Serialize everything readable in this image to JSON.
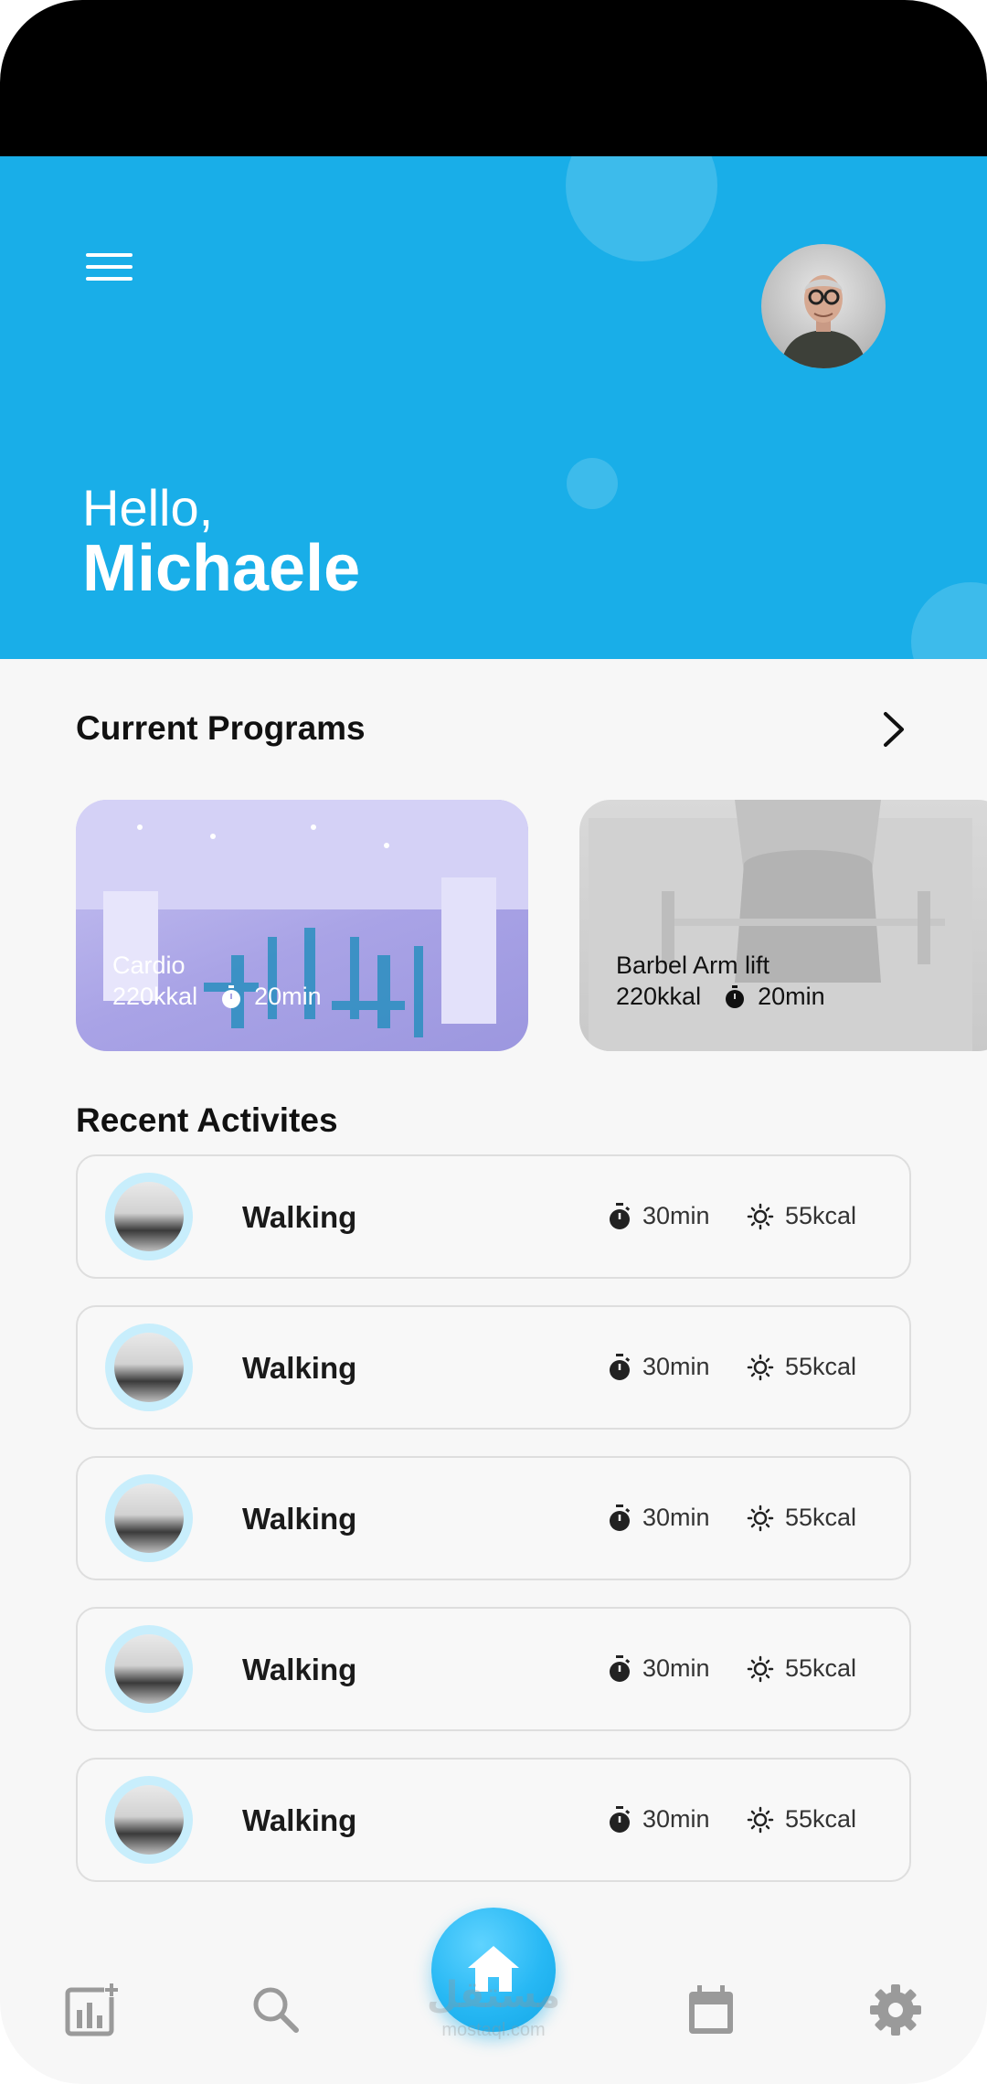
{
  "header": {
    "greeting": "Hello,",
    "user_name": "Michaele",
    "background_color": "#19aee8"
  },
  "current_programs": {
    "title": "Current Programs",
    "cards": [
      {
        "title": "Cardio",
        "calories": "220kkal",
        "duration": "20min"
      },
      {
        "title": "Barbel Arm lift",
        "calories": "220kkal",
        "duration": "20min"
      }
    ]
  },
  "recent_activities": {
    "title": "Recent Activites",
    "items": [
      {
        "name": "Walking",
        "duration": "30min",
        "calories": "55kcal"
      },
      {
        "name": "Walking",
        "duration": "30min",
        "calories": "55kcal"
      },
      {
        "name": "Walking",
        "duration": "30min",
        "calories": "55kcal"
      },
      {
        "name": "Walking",
        "duration": "30min",
        "calories": "55kcal"
      },
      {
        "name": "Walking",
        "duration": "30min",
        "calories": "55kcal"
      }
    ]
  },
  "bottom_nav": {
    "items": [
      "stats-add-icon",
      "search-icon",
      "home-icon",
      "calendar-icon",
      "settings-icon"
    ],
    "active": "home-icon"
  },
  "watermark": {
    "arabic": "مستقل",
    "latin": "mostaql.com"
  }
}
